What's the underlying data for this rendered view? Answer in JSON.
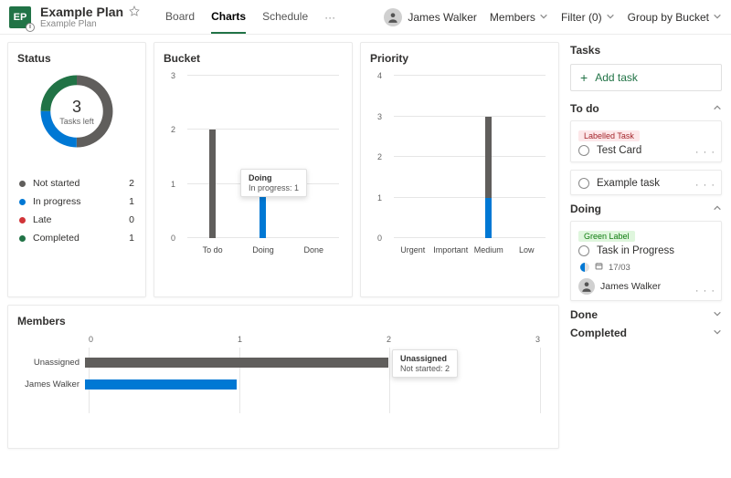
{
  "header": {
    "plan_abbrev": "EP",
    "plan_title": "Example Plan",
    "plan_subtitle": "Example Plan",
    "tabs": [
      "Board",
      "Charts",
      "Schedule"
    ],
    "active_tab": 1,
    "user_name": "James Walker",
    "members_label": "Members",
    "filter_label": "Filter (0)",
    "group_label": "Group by Bucket"
  },
  "status": {
    "title": "Status",
    "center_value": "3",
    "center_label": "Tasks left",
    "legend": [
      {
        "label": "Not started",
        "value": "2",
        "color": "#605e5c"
      },
      {
        "label": "In progress",
        "value": "1",
        "color": "#0078d4"
      },
      {
        "label": "Late",
        "value": "0",
        "color": "#d13438"
      },
      {
        "label": "Completed",
        "value": "1",
        "color": "#217346"
      }
    ]
  },
  "bucket": {
    "title": "Bucket",
    "tooltip_title": "Doing",
    "tooltip_line": "In progress: 1"
  },
  "priority": {
    "title": "Priority"
  },
  "members": {
    "title": "Members",
    "tooltip_title": "Unassigned",
    "tooltip_line": "Not started: 2"
  },
  "right": {
    "tasks_header": "Tasks",
    "add_task": "Add task",
    "sections": {
      "todo": "To do",
      "doing": "Doing",
      "done": "Done",
      "completed": "Completed"
    },
    "todo_tasks": [
      {
        "label": "Labelled Task",
        "label_class": "label-red",
        "title": "Test Card"
      },
      {
        "label": null,
        "title": "Example task"
      }
    ],
    "doing_task": {
      "label": "Green Label",
      "title": "Task in Progress",
      "date": "17/03",
      "assignee": "James Walker"
    }
  },
  "chart_data": [
    {
      "type": "pie",
      "title": "Status",
      "series": [
        {
          "name": "Not started",
          "value": 2,
          "color": "#605e5c"
        },
        {
          "name": "In progress",
          "value": 1,
          "color": "#0078d4"
        },
        {
          "name": "Late",
          "value": 0,
          "color": "#d13438"
        },
        {
          "name": "Completed",
          "value": 1,
          "color": "#217346"
        }
      ],
      "center": {
        "value": 3,
        "label": "Tasks left"
      }
    },
    {
      "type": "bar",
      "title": "Bucket",
      "categories": [
        "To do",
        "Doing",
        "Done"
      ],
      "series": [
        {
          "name": "Not started",
          "color": "#605e5c",
          "values": [
            2,
            0,
            0
          ]
        },
        {
          "name": "In progress",
          "color": "#0078d4",
          "values": [
            0,
            1,
            0
          ]
        },
        {
          "name": "Completed",
          "color": "#217346",
          "values": [
            0,
            0,
            0
          ]
        }
      ],
      "ylim": [
        0,
        3
      ],
      "yticks": [
        0,
        1,
        2,
        3
      ]
    },
    {
      "type": "bar",
      "title": "Priority",
      "categories": [
        "Urgent",
        "Important",
        "Medium",
        "Low"
      ],
      "series": [
        {
          "name": "Not started",
          "color": "#605e5c",
          "values": [
            0,
            0,
            2,
            0
          ]
        },
        {
          "name": "In progress",
          "color": "#0078d4",
          "values": [
            0,
            0,
            1,
            0
          ]
        }
      ],
      "ylim": [
        0,
        4
      ],
      "yticks": [
        0,
        1,
        2,
        3,
        4
      ]
    },
    {
      "type": "bar",
      "title": "Members",
      "orientation": "horizontal",
      "categories": [
        "Unassigned",
        "James Walker"
      ],
      "series": [
        {
          "name": "Not started",
          "color": "#605e5c",
          "values": [
            2,
            0
          ]
        },
        {
          "name": "In progress",
          "color": "#0078d4",
          "values": [
            0,
            1
          ]
        }
      ],
      "xlim": [
        0,
        3
      ],
      "xticks": [
        0,
        1,
        2,
        3
      ]
    }
  ]
}
